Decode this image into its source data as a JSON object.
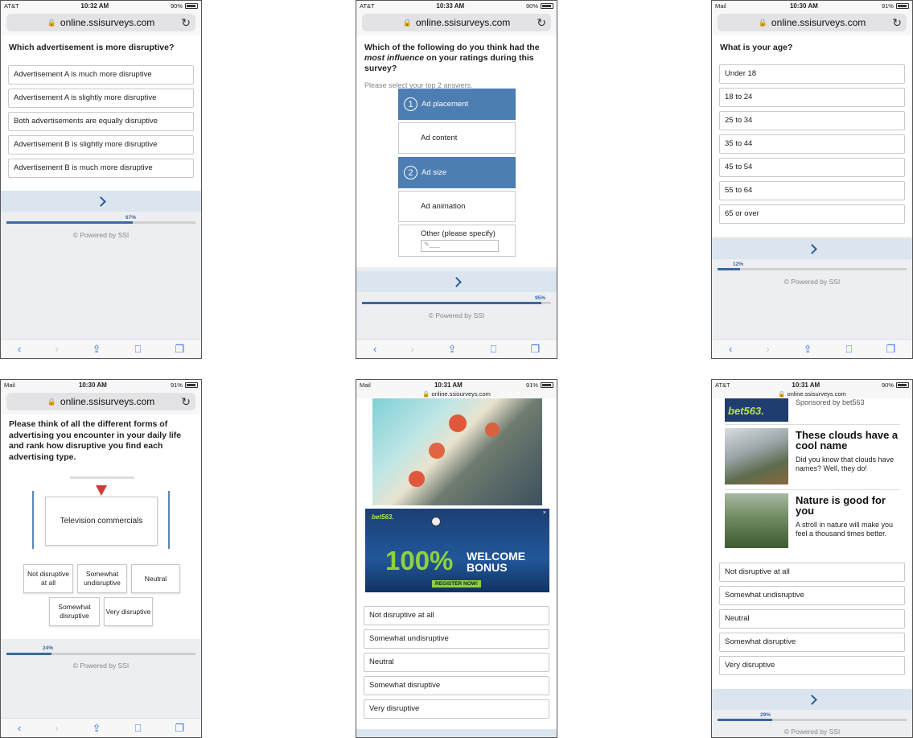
{
  "url": "online.ssisurveys.com",
  "powered": "© Powered by SSI",
  "p1": {
    "carrier": "AT&T",
    "time": "10:32 AM",
    "battery": "90%",
    "question": "Which advertisement is more disruptive?",
    "options": [
      "Advertisement A is much more disruptive",
      "Advertisement A is slightly more disruptive",
      "Both advertisements are equally disruptive",
      "Advertisement B is slightly more disruptive",
      "Advertisement B is much more disruptive"
    ],
    "progress": "67%",
    "progress_value": 67
  },
  "p2": {
    "carrier": "AT&T",
    "time": "10:33 AM",
    "battery": "90%",
    "question_a": "Which of the following do you think had the ",
    "question_em": "most influence",
    "question_b": " on your ratings during this survey?",
    "instruction": "Please select your top 2 answers.",
    "options": [
      {
        "label": "Ad placement",
        "rank": "1"
      },
      {
        "label": "Ad content",
        "rank": ""
      },
      {
        "label": "Ad size",
        "rank": "2"
      },
      {
        "label": "Ad animation",
        "rank": ""
      }
    ],
    "other_label": "Other (please specify)",
    "progress": "95%",
    "progress_value": 95
  },
  "p3": {
    "carrier": "Mail",
    "time": "10:30 AM",
    "battery": "91%",
    "question": "What is your age?",
    "options": [
      "Under 18",
      "18 to 24",
      "25 to 34",
      "35 to 44",
      "45 to 54",
      "55 to 64",
      "65 or over"
    ],
    "progress": "12%",
    "progress_value": 12
  },
  "p4": {
    "carrier": "Mail",
    "time": "10:30 AM",
    "battery": "91%",
    "question": "Please think of all the different forms of advertising you encounter in your daily life and rank how disruptive you find each advertising type.",
    "item": "Television commercials",
    "scale": [
      "Not disruptive at all",
      "Somewhat undisruptive",
      "Neutral",
      "Somewhat disruptive",
      "Very disruptive"
    ],
    "progress": "24%",
    "progress_value": 24
  },
  "p5": {
    "carrier": "Mail",
    "time": "10:31 AM",
    "battery": "91%",
    "ad": {
      "brand": "bet563.",
      "big": "100%",
      "welcome": "WELCOME",
      "bonus": "BONUS",
      "cta": "REGISTER NOW!"
    },
    "options": [
      "Not disruptive at all",
      "Somewhat undisruptive",
      "Neutral",
      "Somewhat disruptive",
      "Very disruptive"
    ]
  },
  "p6": {
    "carrier": "AT&T",
    "time": "10:31 AM",
    "battery": "90%",
    "sponsored": "Sponsored by bet563",
    "brand": "bet563.",
    "news": [
      {
        "title": "These clouds have a cool name",
        "text": "Did you know that clouds have names? Well, they do!"
      },
      {
        "title": "Nature is good for you",
        "text": "A stroll in nature will make you feel a thousand times better."
      }
    ],
    "options": [
      "Not disruptive at all",
      "Somewhat undisruptive",
      "Neutral",
      "Somewhat disruptive",
      "Very disruptive"
    ],
    "progress": "29%",
    "progress_value": 29
  }
}
